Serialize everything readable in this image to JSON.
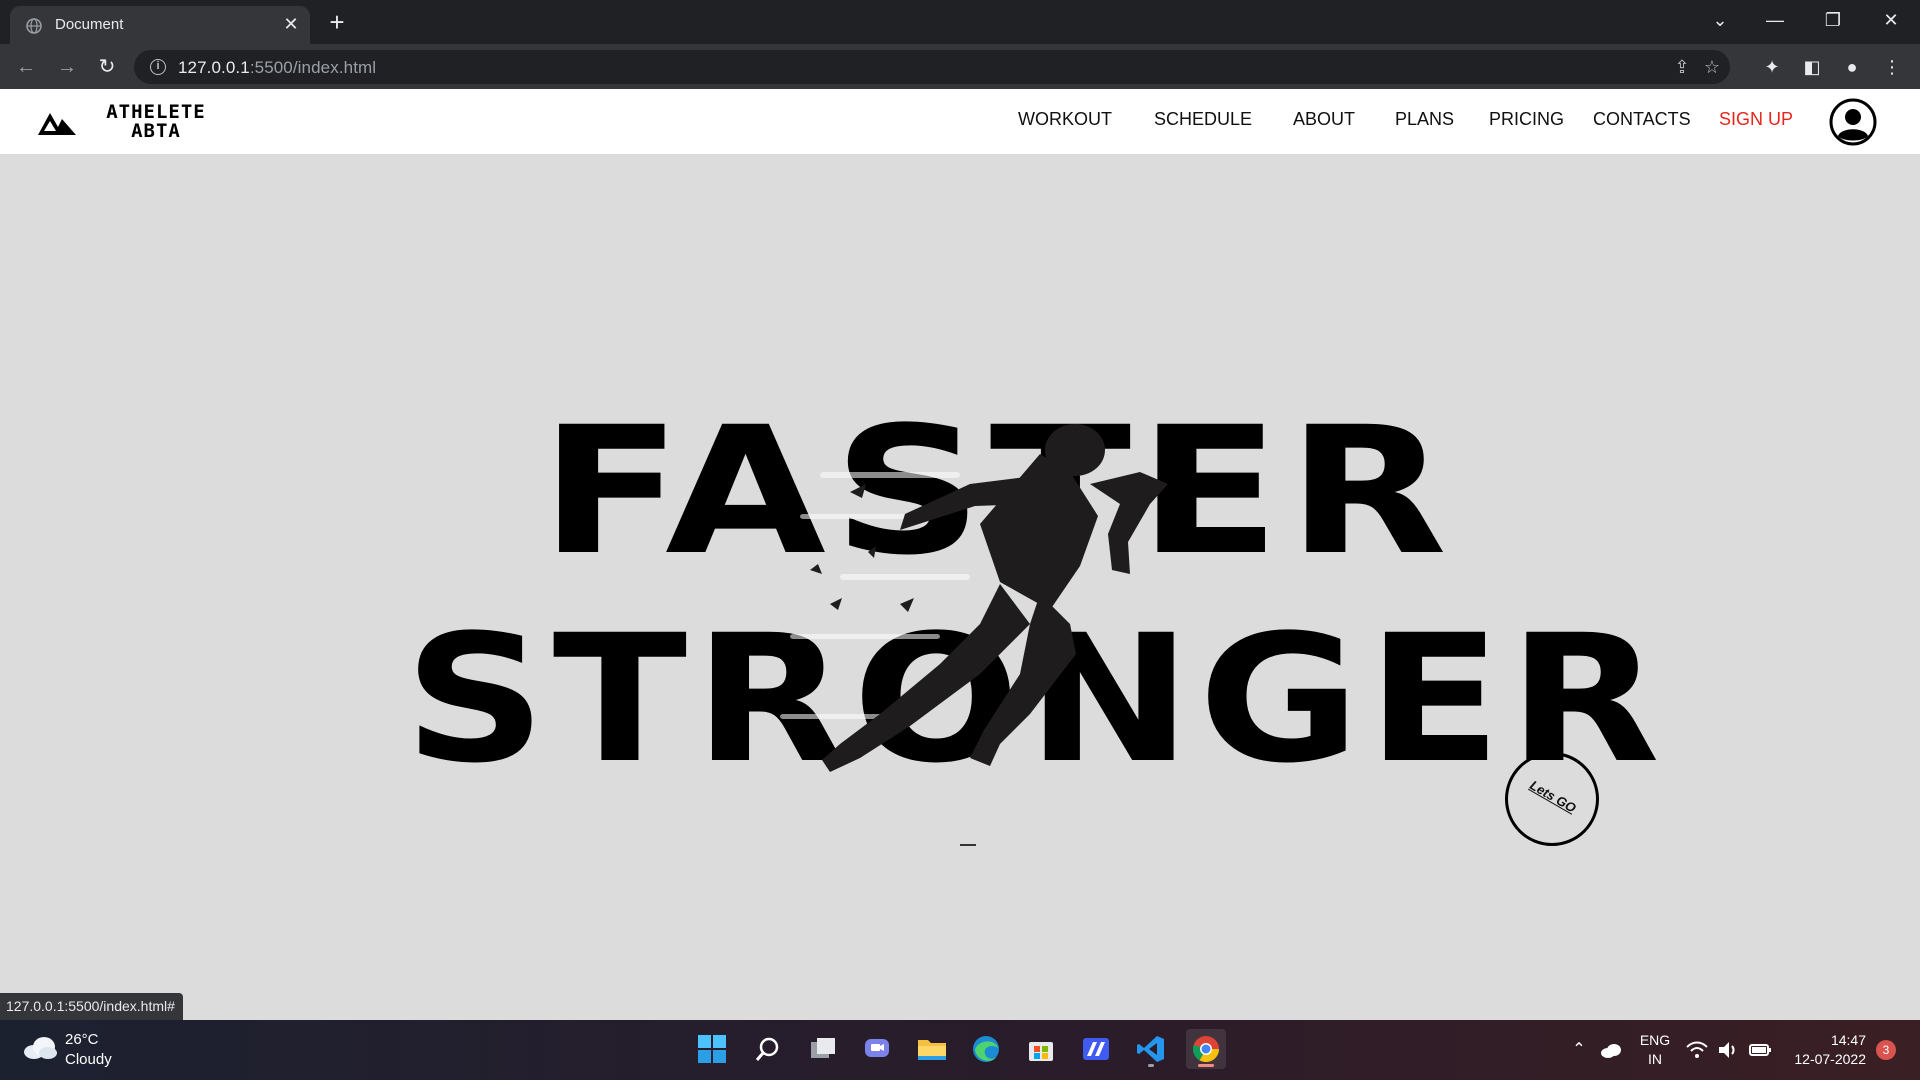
{
  "browser": {
    "tab_title": "Document",
    "url_host": "127.0.0.1",
    "url_rest": ":5500/index.html",
    "status_url": "127.0.0.1:5500/index.html#"
  },
  "site": {
    "logo_line1": "ATHELETE",
    "logo_line2": "ABTA",
    "nav": {
      "workout": "WORKOUT",
      "schedule": "SCHEDULE",
      "about": "ABOUT",
      "plans": "PLANS",
      "pricing": "PRICING",
      "contacts": "CONTACTS",
      "signup": "SIGN UP"
    },
    "hero": {
      "line1": "FASTER",
      "line2": "STRONGER",
      "cta": "Lets GO"
    },
    "colors": {
      "accent": "#e8251c",
      "hero_bg": "#dcdcdc"
    }
  },
  "taskbar": {
    "weather_temp": "26°C",
    "weather_desc": "Cloudy",
    "lang_line1": "ENG",
    "lang_line2": "IN",
    "time": "14:47",
    "date": "12-07-2022",
    "notification_count": "3",
    "apps": [
      "start-icon",
      "search-icon",
      "task-view-icon",
      "teams-chat-icon",
      "file-explorer-icon",
      "edge-icon",
      "store-icon",
      "app-icon",
      "vscode-icon",
      "chrome-icon"
    ]
  }
}
